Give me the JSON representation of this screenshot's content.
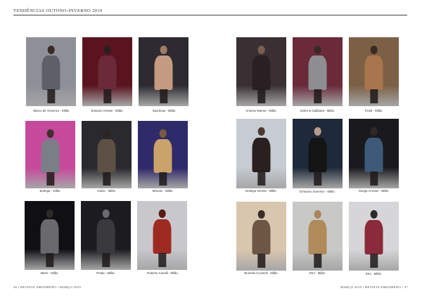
{
  "header": {
    "title": "TENDÊNCIAS OUTONO-INVERNO 2019"
  },
  "footer": {
    "left": "36 • REVISTA AMOORENO • MARÇO 2019",
    "right": "MARÇO 2019 • REVISTA AMOORENO • 37"
  },
  "photos": [
    {
      "caption": "Marco de Vincenzo - Milão",
      "colors": {
        "bg": "#8e9098",
        "coat": "#5e6068",
        "head": "#3a2a25"
      }
    },
    {
      "caption": "Emporio Armani - Milão",
      "colors": {
        "bg": "#5a1420",
        "coat": "#6b2a3a",
        "head": "#2a1f1f"
      }
    },
    {
      "caption": "Sportmax - Milão",
      "colors": {
        "bg": "#2d2b31",
        "coat": "#c49a80",
        "head": "#a27a64"
      }
    },
    {
      "caption": "Bottega - Milão",
      "colors": {
        "bg": "#c64a9b",
        "coat": "#7a7e86",
        "head": "#3d3030"
      }
    },
    {
      "caption": "Calvin - Milão",
      "colors": {
        "bg": "#2a2a2e",
        "coat": "#5d5044",
        "head": "#2e2422"
      }
    },
    {
      "caption": "Missoni - Milão",
      "colors": {
        "bg": "#2f2a6a",
        "coat": "#caa36a",
        "head": "#7a5c3e"
      }
    },
    {
      "caption": "Marni - Milão",
      "colors": {
        "bg": "#101014",
        "coat": "#6a6a6e",
        "head": "#302826"
      }
    },
    {
      "caption": "Prada - Milão",
      "colors": {
        "bg": "#1c1c20",
        "coat": "#3a3a3e",
        "head": "#6a6a70"
      }
    },
    {
      "caption": "Roberto Cavalli - Milão",
      "colors": {
        "bg": "#c8c8cc",
        "coat": "#9e2a22",
        "head": "#5a1a16"
      }
    },
    {
      "caption": "Antonio Marras - Milão",
      "colors": {
        "bg": "#3a3034",
        "coat": "#2a1f22",
        "head": "#7a5f4e"
      }
    },
    {
      "caption": "Dolce & Gabbana - Milão",
      "colors": {
        "bg": "#6a2a3a",
        "coat": "#8e8e92",
        "head": "#3a2a26"
      }
    },
    {
      "caption": "Fendi - Milão",
      "colors": {
        "bg": "#7c6046",
        "coat": "#a8764e",
        "head": "#3a2a22"
      }
    },
    {
      "caption": "Bottega Veneta - Milão",
      "colors": {
        "bg": "#c6ccd2",
        "coat": "#2a2020",
        "head": "#4a3a32"
      }
    },
    {
      "caption": "Ermanno Scervino - Milão",
      "colors": {
        "bg": "#1e2a3a",
        "coat": "#141414",
        "head": "#b89a8a"
      }
    },
    {
      "caption": "Giorgio Armani - Milão",
      "colors": {
        "bg": "#1a1a1e",
        "coat": "#3e5a7a",
        "head": "#2e2828"
      }
    },
    {
      "caption": "Brunello Cucinelli - Milão",
      "colors": {
        "bg": "#d8c6ae",
        "coat": "#6e5644",
        "head": "#3a2e28"
      }
    },
    {
      "caption": "Etro - Milão",
      "colors": {
        "bg": "#c8c8c6",
        "coat": "#b08a5a",
        "head": "#a8865a"
      }
    },
    {
      "caption": "Etro - Milão",
      "colors": {
        "bg": "#d6d6d8",
        "coat": "#8a2a3a",
        "head": "#2a2a2a"
      }
    }
  ]
}
